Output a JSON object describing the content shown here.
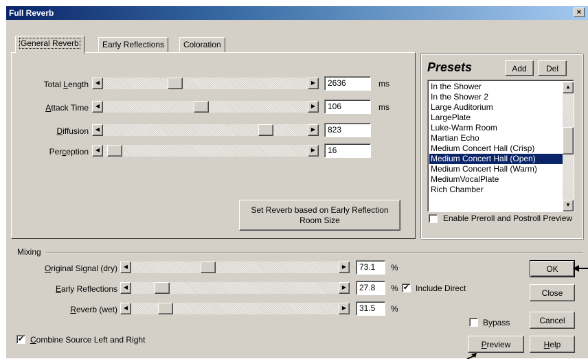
{
  "window": {
    "title": "Full Reverb",
    "close_glyph": "×"
  },
  "tabs": [
    {
      "label": "General Reverb",
      "active": true
    },
    {
      "label": "Early Reflections",
      "active": false
    },
    {
      "label": "Coloration",
      "active": false
    }
  ],
  "general": {
    "rows": [
      {
        "label_pre": "Total ",
        "label_u": "L",
        "label_post": "ength",
        "value": "2636",
        "unit": "ms",
        "level": 0.34
      },
      {
        "label_pre": "",
        "label_u": "A",
        "label_post": "ttack Time",
        "value": "106",
        "unit": "ms",
        "level": 0.48
      },
      {
        "label_pre": "",
        "label_u": "D",
        "label_post": "iffusion",
        "value": "823",
        "unit": "",
        "level": 0.82
      },
      {
        "label_pre": "Per",
        "label_u": "c",
        "label_post": "eption",
        "value": "16",
        "unit": "",
        "level": 0.02
      }
    ],
    "set_reverb_button": "Set Reverb based on Early Reflection Room Size"
  },
  "presets": {
    "title": "Presets",
    "add_label": "Add",
    "del_label": "Del",
    "items": [
      "In the Shower",
      "In the Shower 2",
      "Large Auditorium",
      "LargePlate",
      "Luke-Warm Room",
      "Martian Echo",
      "Medium Concert Hall (Crisp)",
      "Medium Concert Hall (Open)",
      "Medium Concert Hall (Warm)",
      "MediumVocalPlate",
      "Rich Chamber"
    ],
    "selected_index": 7,
    "enable_preroll": {
      "label": "Enable Preroll and Postroll Preview",
      "checked": false
    }
  },
  "mixing": {
    "title": "Mixing",
    "rows": [
      {
        "label_pre": "",
        "label_u": "O",
        "label_post": "riginal Signal (dry)",
        "value": "73.1",
        "unit": "%",
        "level": 0.36
      },
      {
        "label_pre": "",
        "label_u": "E",
        "label_post": "arly Reflections",
        "value": "27.8",
        "unit": "%",
        "level": 0.12
      },
      {
        "label_pre": "",
        "label_u": "R",
        "label_post": "everb (wet)",
        "value": "31.5",
        "unit": "%",
        "level": 0.14
      }
    ],
    "include_direct": {
      "label": "Include Direct",
      "checked": true
    },
    "combine_source": {
      "label_pre": "",
      "label_u": "C",
      "label_post": "ombine Source Left and Right",
      "checked": true
    },
    "bypass": {
      "label": "Bypass",
      "checked": false
    }
  },
  "buttons": {
    "ok": "OK",
    "close": "Close",
    "cancel": "Cancel",
    "help_u": "H",
    "help_post": "elp",
    "preview_u": "P",
    "preview_post": "review"
  },
  "icons": {
    "left_arrow": "◀",
    "right_arrow": "▶",
    "up_arrow": "▲",
    "down_arrow": "▼",
    "check": "✔"
  }
}
